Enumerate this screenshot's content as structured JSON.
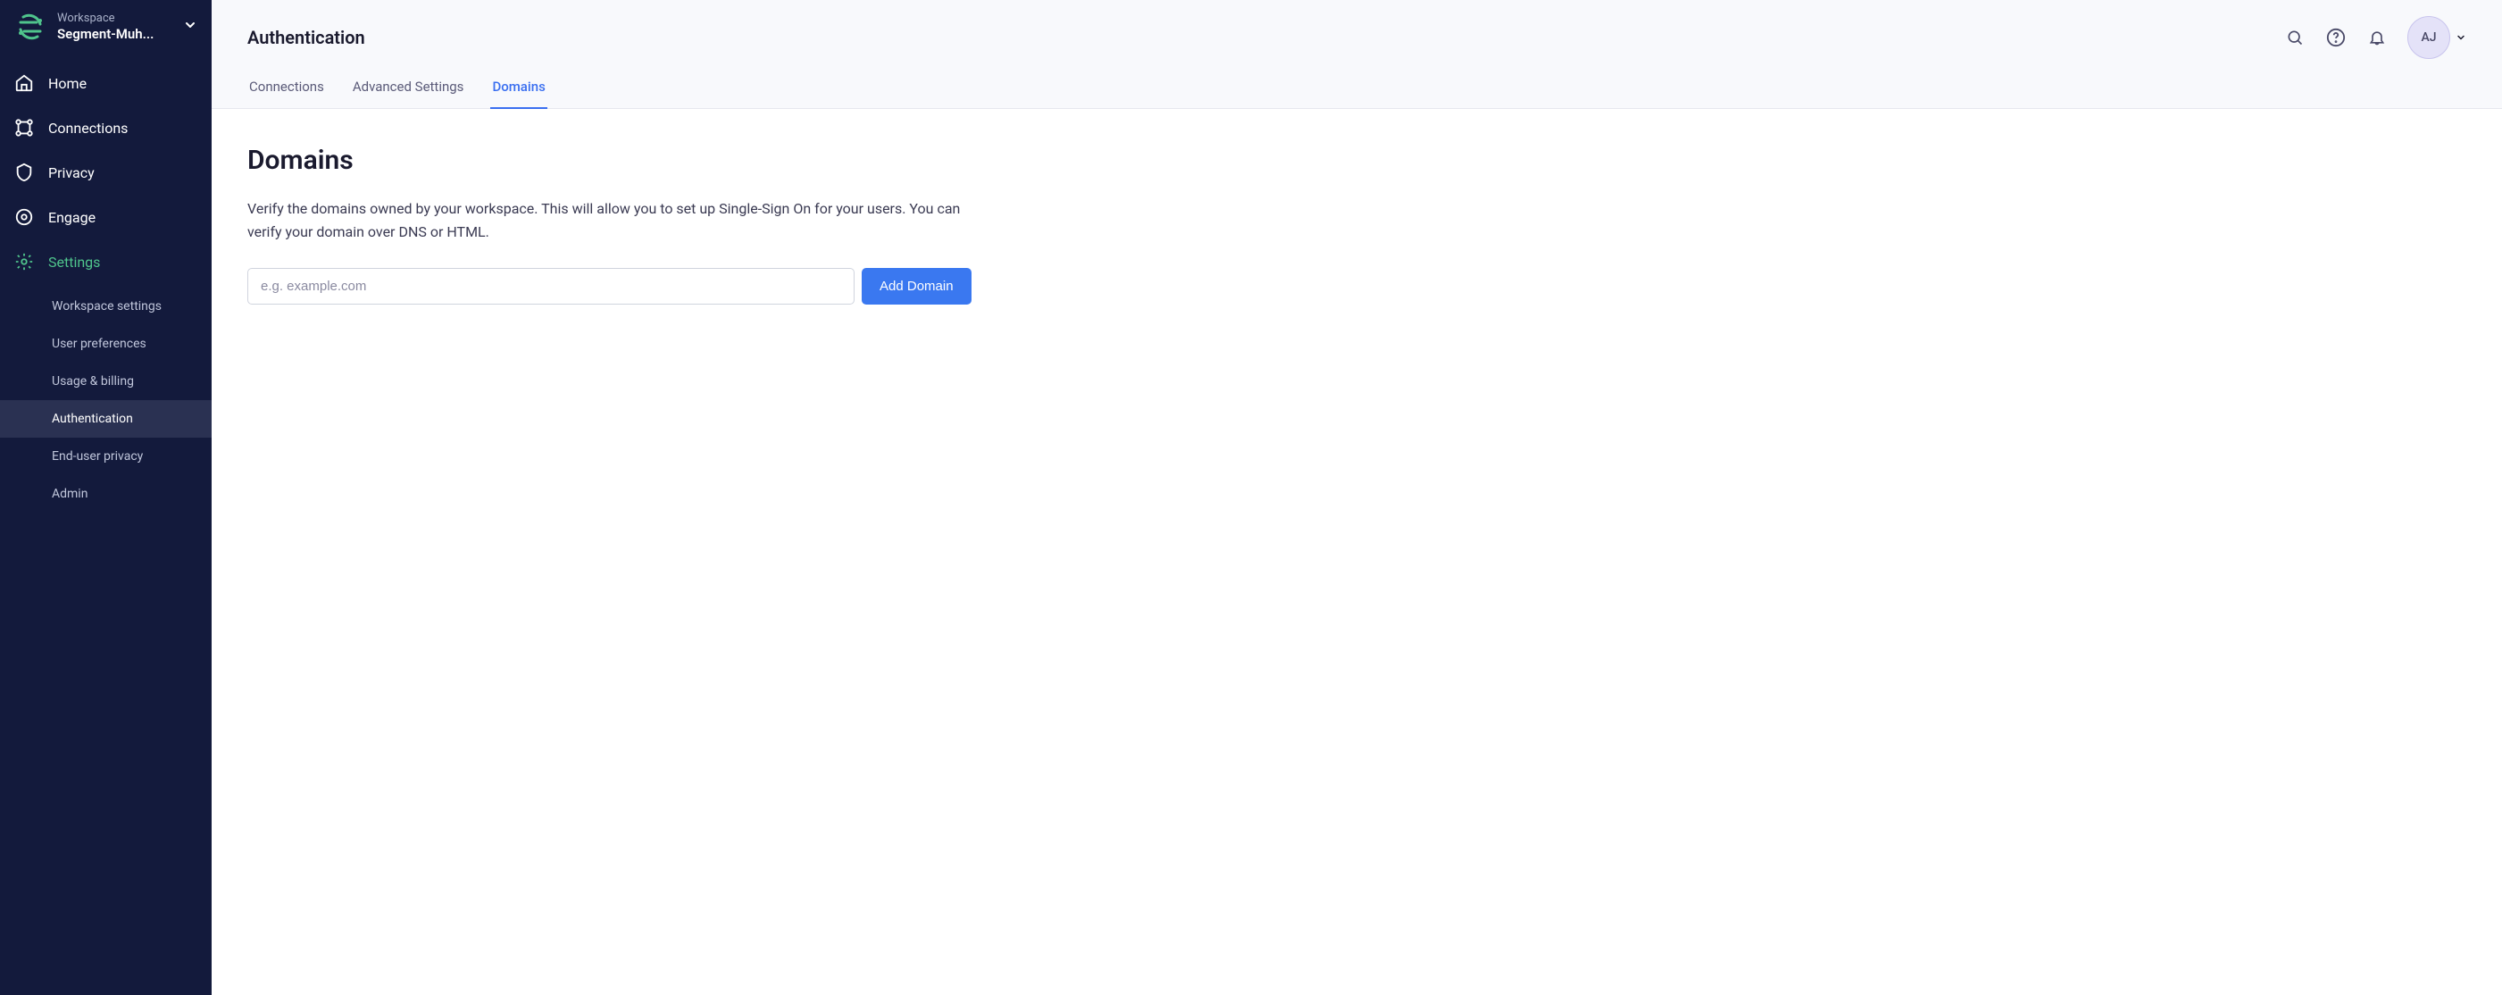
{
  "workspace": {
    "label": "Workspace",
    "name": "Segment-Muh..."
  },
  "sidebar": {
    "items": [
      {
        "label": "Home"
      },
      {
        "label": "Connections"
      },
      {
        "label": "Privacy"
      },
      {
        "label": "Engage"
      },
      {
        "label": "Settings"
      }
    ],
    "subItems": [
      {
        "label": "Workspace settings"
      },
      {
        "label": "User preferences"
      },
      {
        "label": "Usage & billing"
      },
      {
        "label": "Authentication"
      },
      {
        "label": "End-user privacy"
      },
      {
        "label": "Admin"
      }
    ]
  },
  "header": {
    "title": "Authentication",
    "avatar": "AJ"
  },
  "tabs": [
    {
      "label": "Connections"
    },
    {
      "label": "Advanced Settings"
    },
    {
      "label": "Domains"
    }
  ],
  "main": {
    "title": "Domains",
    "description": "Verify the domains owned by your workspace. This will allow you to set up Single-Sign On for your users. You can verify your domain over DNS or HTML.",
    "input_placeholder": "e.g. example.com",
    "button_label": "Add Domain"
  }
}
